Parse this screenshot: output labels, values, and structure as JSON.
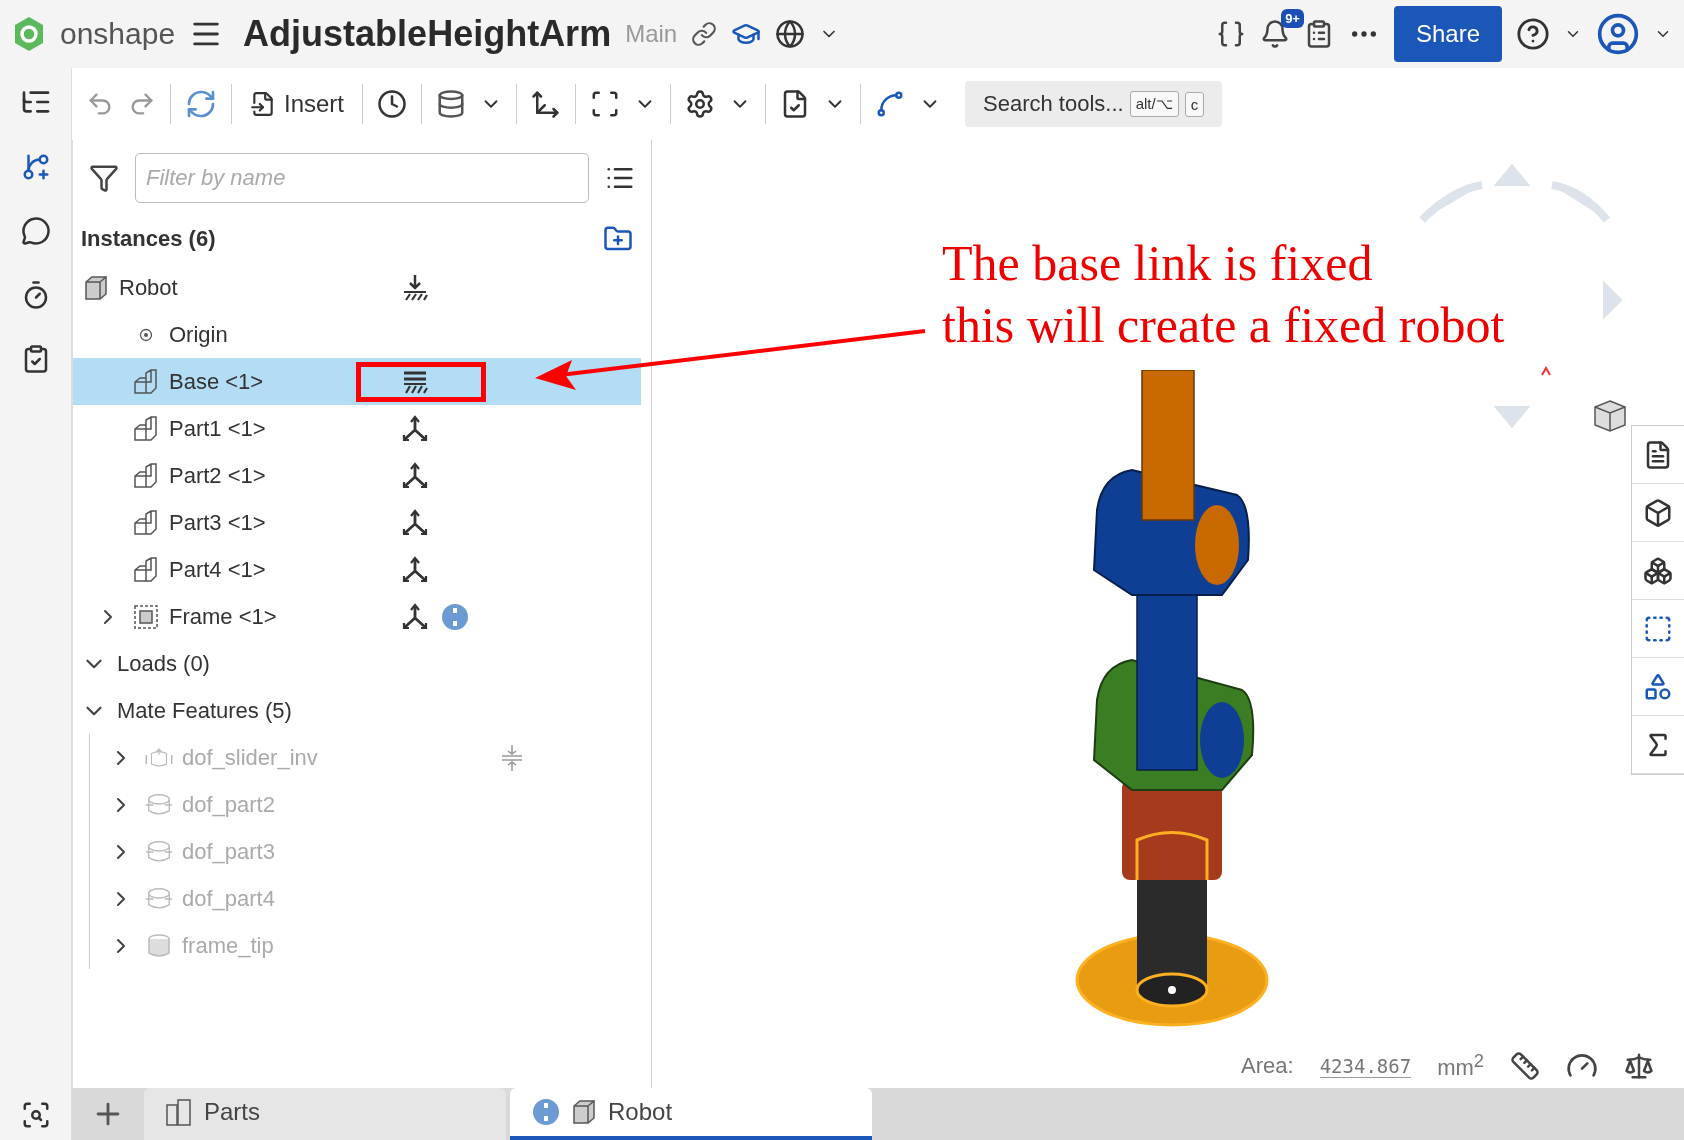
{
  "header": {
    "logo_text": "onshape",
    "document_title": "AdjustableHeightArm",
    "branch": "Main",
    "notification_count": "9+",
    "share_button": "Share"
  },
  "toolbar": {
    "insert_button": "Insert",
    "search": {
      "placeholder": "Search tools...",
      "shortcut_keys": [
        "alt/⌥",
        "c"
      ]
    }
  },
  "feature_panel": {
    "filter": {
      "placeholder": "Filter by name"
    },
    "instances_title": "Instances (6)",
    "instances": [
      {
        "name": "Robot",
        "kind": "assembly",
        "mate": {
          "kind": "fixed-ground"
        },
        "selected": false,
        "highlighted": false,
        "children": [
          {
            "name": "Origin",
            "kind": "origin",
            "selected": false,
            "highlighted": false
          },
          {
            "name": "Base <1>",
            "kind": "part",
            "mate": {
              "kind": "fixed"
            },
            "selected": true,
            "highlighted": true
          },
          {
            "name": "Part1 <1>",
            "kind": "part",
            "mate": {
              "kind": "free"
            },
            "selected": false,
            "highlighted": false
          },
          {
            "name": "Part2 <1>",
            "kind": "part",
            "mate": {
              "kind": "free"
            },
            "selected": false,
            "highlighted": false
          },
          {
            "name": "Part3 <1>",
            "kind": "part",
            "mate": {
              "kind": "free"
            },
            "selected": false,
            "highlighted": false
          },
          {
            "name": "Part4 <1>",
            "kind": "part",
            "mate": {
              "kind": "free"
            },
            "selected": false,
            "highlighted": false
          },
          {
            "name": "Frame <1>",
            "kind": "subassembly",
            "mate": {
              "kind": "free"
            },
            "info_badge": true,
            "expanded": false,
            "selected": false,
            "highlighted": false
          }
        ]
      }
    ],
    "sections": [
      {
        "label": "Loads (0)",
        "expanded": true
      },
      {
        "label": "Mate Features (5)",
        "expanded": true,
        "children": [
          {
            "name": "dof_slider_inv",
            "kind": "slider",
            "limits": true,
            "expanded": false,
            "disabled": true
          },
          {
            "name": "dof_part2",
            "kind": "revolute",
            "expanded": false,
            "disabled": true
          },
          {
            "name": "dof_part3",
            "kind": "revolute",
            "expanded": false,
            "disabled": true
          },
          {
            "name": "dof_part4",
            "kind": "revolute",
            "expanded": false,
            "disabled": true
          },
          {
            "name": "frame_tip",
            "kind": "connector",
            "expanded": false,
            "disabled": true
          }
        ]
      }
    ]
  },
  "annotation": {
    "lines": [
      "The base link is fixed",
      "this will create a fixed robot"
    ]
  },
  "measurement": {
    "label": "Area:",
    "value": "4234.867",
    "unit": "mm$^{2}$"
  },
  "tabs": [
    {
      "label": "Parts",
      "kind": "part-studio",
      "selected": false
    },
    {
      "label": "Robot",
      "kind": "assembly",
      "selected": true
    }
  ]
}
